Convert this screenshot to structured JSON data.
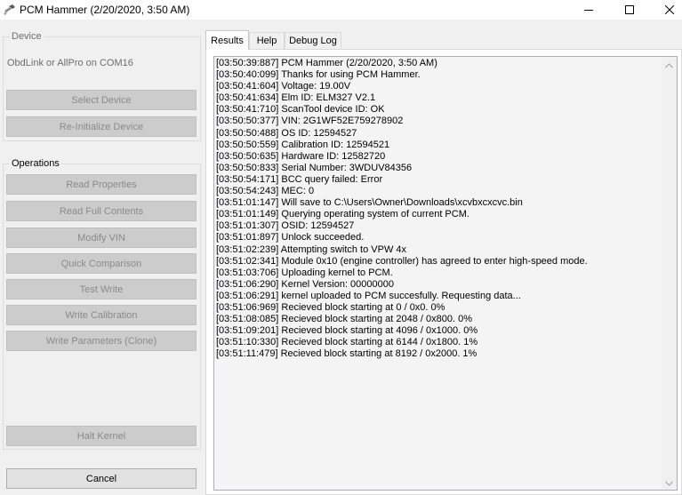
{
  "window": {
    "title": "PCM Hammer (2/20/2020, 3:50 AM)",
    "icons": {
      "app": "hammer-icon",
      "minimize": "minimize-icon",
      "maximize": "maximize-icon",
      "close": "close-icon"
    }
  },
  "device": {
    "legend": "Device",
    "status": "ObdLink or AllPro on COM16",
    "select_label": "Select Device",
    "reinit_label": "Re-Initialize Device"
  },
  "operations": {
    "legend": "Operations",
    "read_properties": "Read Properties",
    "read_full_contents": "Read Full Contents",
    "modify_vin": "Modify VIN",
    "quick_comparison": "Quick Comparison",
    "test_write": "Test Write",
    "write_calibration": "Write Calibration",
    "write_parameters": "Write Parameters (Clone)",
    "halt_kernel": "Halt Kernel",
    "cancel": "Cancel"
  },
  "tabs": {
    "results": "Results",
    "help": "Help",
    "debug_log": "Debug Log"
  },
  "log": [
    "[03:50:39:887]  PCM Hammer (2/20/2020, 3:50 AM)",
    "[03:50:40:099]  Thanks for using PCM Hammer.",
    "[03:50:41:604]  Voltage: 19.00V",
    "[03:50:41:634]  Elm ID: ELM327 V2.1",
    "[03:50:41:710]  ScanTool device ID: OK",
    "[03:50:50:377]  VIN: 2G1WF52E759278902",
    "[03:50:50:488]  OS ID: 12594527",
    "[03:50:50:559]  Calibration ID: 12594521",
    "[03:50:50:635]  Hardware ID: 12582720",
    "[03:50:50:833]  Serial Number: 3WDUV84356",
    "[03:50:54:171]  BCC query failed: Error",
    "[03:50:54:243]  MEC: 0",
    "[03:51:01:147]  Will save to C:\\Users\\Owner\\Downloads\\xcvbxcxcvc.bin",
    "[03:51:01:149]  Querying operating system of current PCM.",
    "[03:51:01:307]  OSID: 12594527",
    "[03:51:01:897]  Unlock succeeded.",
    "[03:51:02:239]  Attempting switch to VPW 4x",
    "[03:51:02:341]  Module 0x10 (engine controller) has agreed to enter high-speed mode.",
    "[03:51:03:706]  Uploading kernel to PCM.",
    "[03:51:06:290]  Kernel Version: 00000000",
    "[03:51:06:291]  kernel uploaded to PCM succesfully. Requesting data...",
    "[03:51:06:969]  Recieved block starting at 0 / 0x0. 0%",
    "[03:51:08:085]  Recieved block starting at 2048 / 0x800. 0%",
    "[03:51:09:201]  Recieved block starting at 4096 / 0x1000. 0%",
    "[03:51:10:330]  Recieved block starting at 6144 / 0x1800. 1%",
    "[03:51:11:479]  Recieved block starting at 8192 / 0x2000. 1%"
  ],
  "scrollbar": {
    "up_icon": "scroll-up-icon",
    "down_icon": "scroll-down-icon"
  }
}
